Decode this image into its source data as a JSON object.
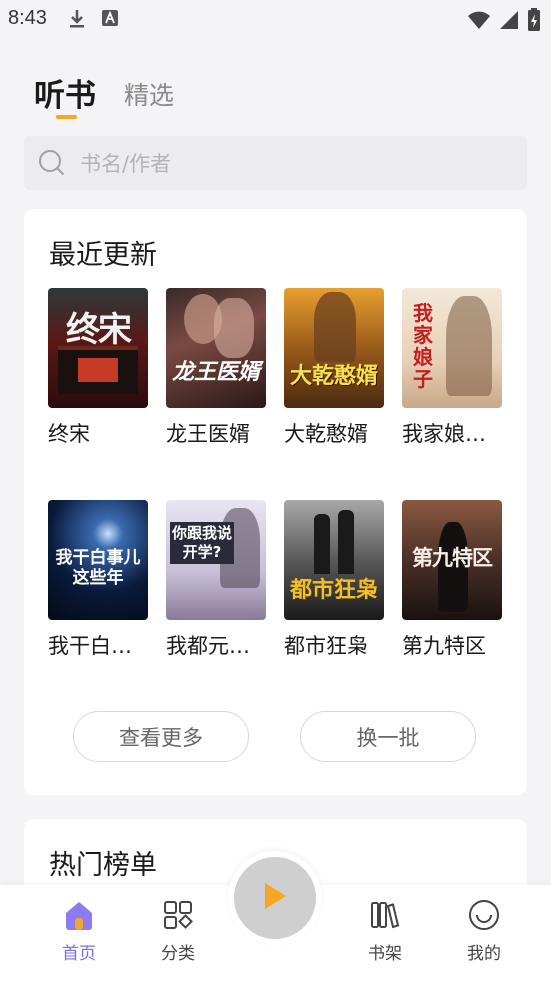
{
  "status_bar": {
    "time": "8:43"
  },
  "tabs": [
    {
      "label": "听书"
    },
    {
      "label": "精选"
    }
  ],
  "search": {
    "placeholder": "书名/作者"
  },
  "recent": {
    "title": "最近更新",
    "books": [
      {
        "title": "终宋",
        "cover_text": "终宋"
      },
      {
        "title": "龙王医婿",
        "cover_text": "龙王医婿"
      },
      {
        "title": "大乾憨婿",
        "cover_text": "大乾憨婿"
      },
      {
        "title": "我家娘…",
        "cover_text": "我家娘子"
      },
      {
        "title": "我干白…",
        "cover_text": "我干白事儿这些年"
      },
      {
        "title": "我都元…",
        "cover_text": "你跟我说开学?"
      },
      {
        "title": "都市狂枭",
        "cover_text": "都市狂枭"
      },
      {
        "title": "第九特区",
        "cover_text": "第九特区"
      }
    ],
    "more_label": "查看更多",
    "refresh_label": "换一批"
  },
  "hot": {
    "title": "热门榜单"
  },
  "bottom_nav": [
    {
      "label": "首页",
      "icon": "home-icon",
      "active": true
    },
    {
      "label": "分类",
      "icon": "category-icon"
    },
    {
      "label": "书架",
      "icon": "bookshelf-icon"
    },
    {
      "label": "我的",
      "icon": "profile-icon"
    }
  ],
  "colors": {
    "accent": "#f5a623",
    "nav_active": "#7a6cf0"
  }
}
